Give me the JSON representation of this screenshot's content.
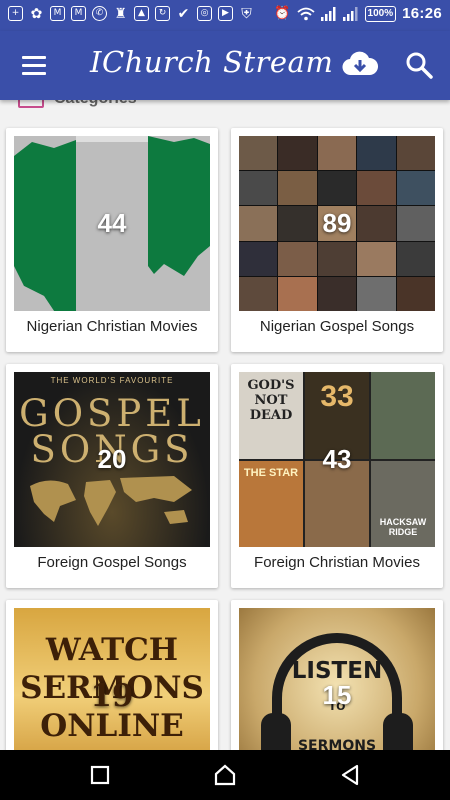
{
  "status_bar": {
    "time": "16:26",
    "battery": "100%",
    "left_icons": [
      "add-box-icon",
      "flower-icon",
      "gmail-icon",
      "gmail-icon",
      "whatsapp-icon",
      "cleaner-icon",
      "image-icon",
      "sync-icon",
      "check-icon",
      "instagram-icon",
      "youtube-icon",
      "shield-icon"
    ],
    "right_icons": [
      "alarm-icon",
      "wifi-icon",
      "signal-icon",
      "signal-icon",
      "battery-icon"
    ]
  },
  "app_bar": {
    "title": "IChurch Stream",
    "color": "#3a4fa9",
    "actions": [
      "menu-icon",
      "cloud-download-icon",
      "search-icon"
    ]
  },
  "section": {
    "title": "Categories",
    "icon": "categories-icon"
  },
  "categories": [
    {
      "label": "Nigerian Christian Movies",
      "count": "44"
    },
    {
      "label": "Nigerian Gospel Songs",
      "count": "89"
    },
    {
      "label": "Foreign Gospel Songs",
      "count": "20"
    },
    {
      "label": "Foreign Christian Movies",
      "count": "43"
    },
    {
      "label": "",
      "count": "19"
    },
    {
      "label": "",
      "count": "15"
    }
  ],
  "artwork": {
    "gospel": {
      "line1": "THE WORLD'S FAVOURITE",
      "line2": "GOSPEL",
      "line3": "SONGS"
    },
    "posters": [
      "GOD'S NOT DEAD",
      "33",
      "",
      "THE STAR",
      "",
      "HACKSAW RIDGE"
    ],
    "watch": [
      "WATCH",
      "SERMONS",
      "ONLINE"
    ],
    "listen": [
      "LISTEN",
      "TO",
      "SERMONS"
    ]
  },
  "nav_bar": {
    "buttons": [
      "recents-icon",
      "home-icon",
      "back-icon"
    ]
  }
}
